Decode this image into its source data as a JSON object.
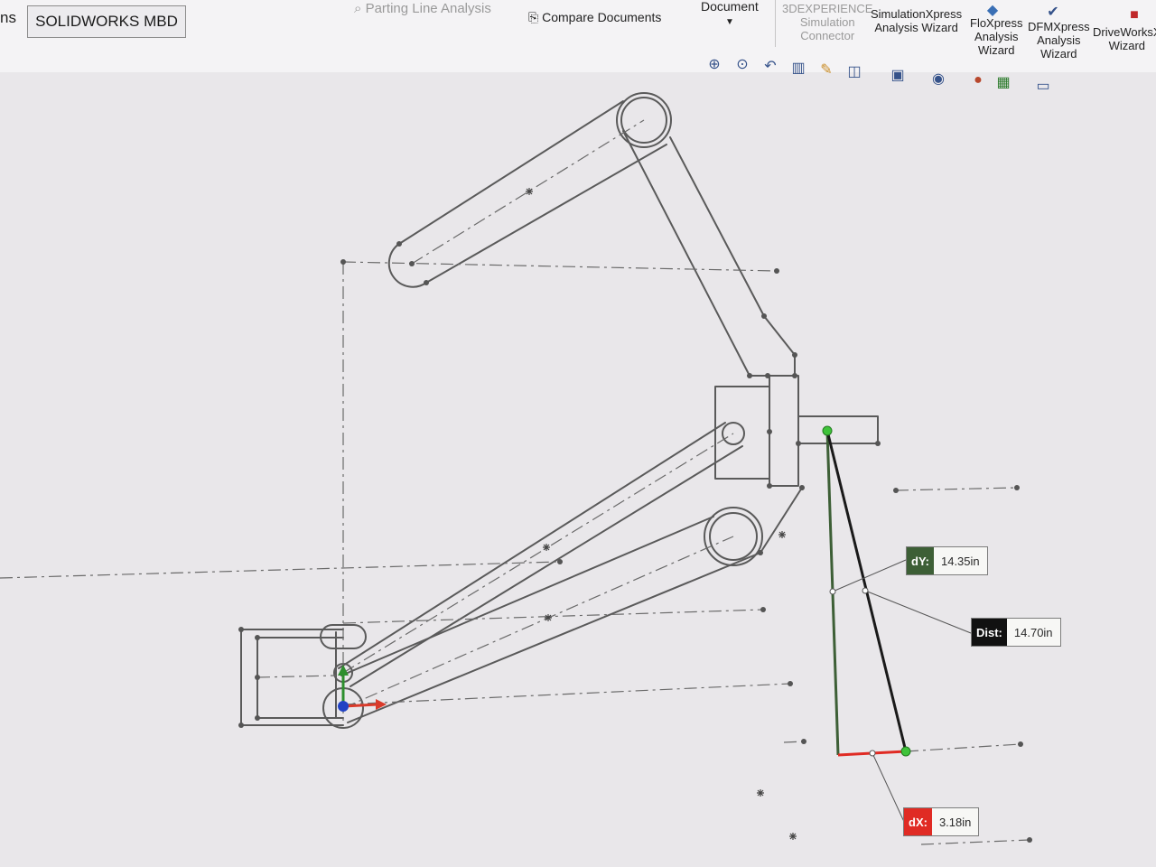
{
  "ribbon": {
    "tab_partial": "ns",
    "tab_active": "SOLIDWORKS MBD",
    "parting_line": "Parting Line Analysis",
    "compare_documents": "Compare Documents",
    "document": "Document",
    "experience": "3DEXPERIENCE\nSimulation\nConnector",
    "simxpress": "SimulationXpress\nAnalysis Wizard",
    "floxpress": "FloXpress\nAnalysis\nWizard",
    "dfmxpress": "DFMXpress\nAnalysis\nWizard",
    "driveworks": "DriveWorksX\nWizard"
  },
  "view_toolbar_icons": [
    "zoom-to-fit-icon",
    "zoom-area-icon",
    "previous-view-icon",
    "section-view-icon",
    "dynamic-annotation-icon",
    "view-orientation-icon",
    "display-style-icon",
    "hide-show-icon",
    "edit-appearance-icon",
    "apply-scene-icon",
    "view-settings-icon"
  ],
  "measure": {
    "dy_label": "dY:",
    "dy_value": "14.35in",
    "dist_label": "Dist:",
    "dist_value": "14.70in",
    "dx_label": "dX:",
    "dx_value": "3.18in"
  },
  "colors": {
    "sketch_line": "#555555",
    "dy_tag": "#3d5f36",
    "dist_tag": "#111111",
    "dx_tag": "#e02b24",
    "green_point": "#3fc33a"
  }
}
